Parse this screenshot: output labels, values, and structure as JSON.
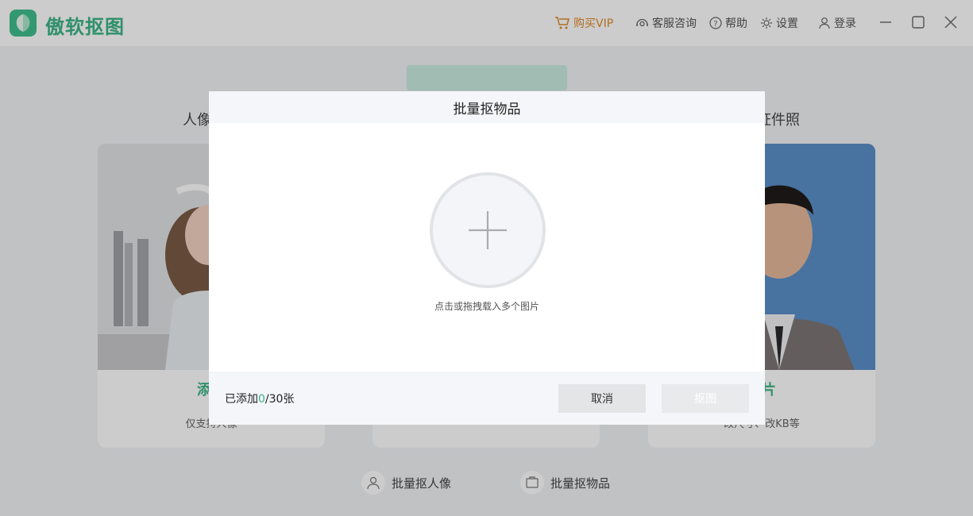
{
  "app": {
    "title": "傲软抠图"
  },
  "topnav": {
    "vip": "购买VIP",
    "support": "客服咨询",
    "help": "帮助",
    "settings": "设置",
    "login": "登录"
  },
  "background": {
    "section_left": "人像",
    "section_right": "证件照",
    "cards": [
      {
        "title": "添加",
        "subtitle": "仅支持人像"
      },
      {
        "title": "",
        "subtitle": ""
      },
      {
        "title": "图片",
        "subtitle": "改尺寸、改KB等"
      }
    ],
    "bottom_links": [
      "批量抠人像",
      "批量抠物品"
    ]
  },
  "modal": {
    "title": "批量抠物品",
    "drop_hint": "点击或拖拽载入多个图片",
    "count_prefix": "已添加",
    "count_value": "0",
    "count_suffix": "/30张",
    "cancel_label": "取消",
    "cut_label": "抠图"
  },
  "colors": {
    "accent": "#3bb487",
    "vip": "#e08a2a"
  }
}
